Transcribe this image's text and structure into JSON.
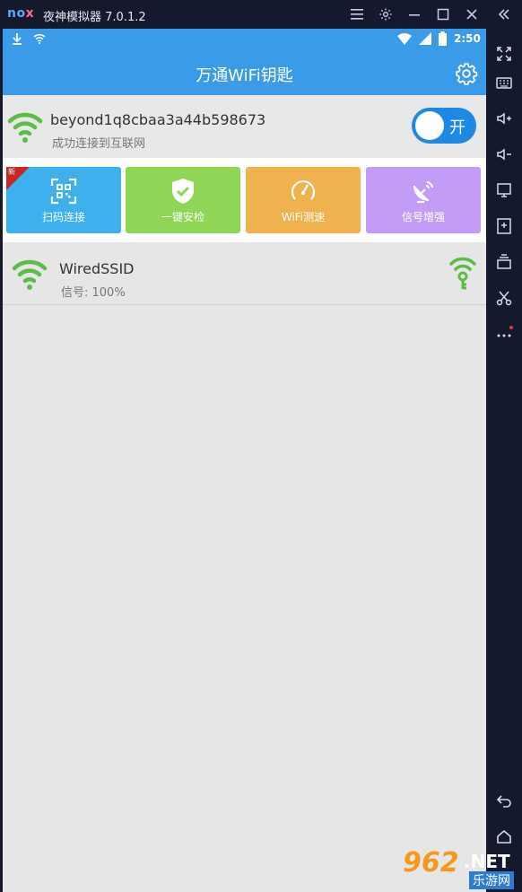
{
  "emulator": {
    "logo_part1": "no",
    "logo_part2": "x",
    "title": "夜神模拟器 7.0.1.2"
  },
  "statusbar": {
    "time": "2:50"
  },
  "app": {
    "title": "万通WiFi钥匙"
  },
  "connection": {
    "ssid": "beyond1q8cbaa3a44b598673",
    "status": "成功连接到互联网",
    "toggle_label": "开"
  },
  "tiles": [
    {
      "label": "扫码连接",
      "color": "#3fb0ee",
      "icon": "qr-scan-icon",
      "badge": "新"
    },
    {
      "label": "一键安检",
      "color": "#8fd556",
      "icon": "shield-check-icon"
    },
    {
      "label": "WiFi测速",
      "color": "#efb24f",
      "icon": "speedometer-icon"
    },
    {
      "label": "信号增强",
      "color": "#c39cf8",
      "icon": "satellite-dish-icon"
    }
  ],
  "networks": [
    {
      "name": "WiredSSID",
      "signal": "信号: 100%"
    }
  ],
  "watermark": {
    "main": "962",
    "suffix": ".NET",
    "sub": "乐游网"
  },
  "colors": {
    "appbar": "#3a9be8",
    "wifi_green": "#5dbb47",
    "toggle_blue": "#1e88e5"
  }
}
